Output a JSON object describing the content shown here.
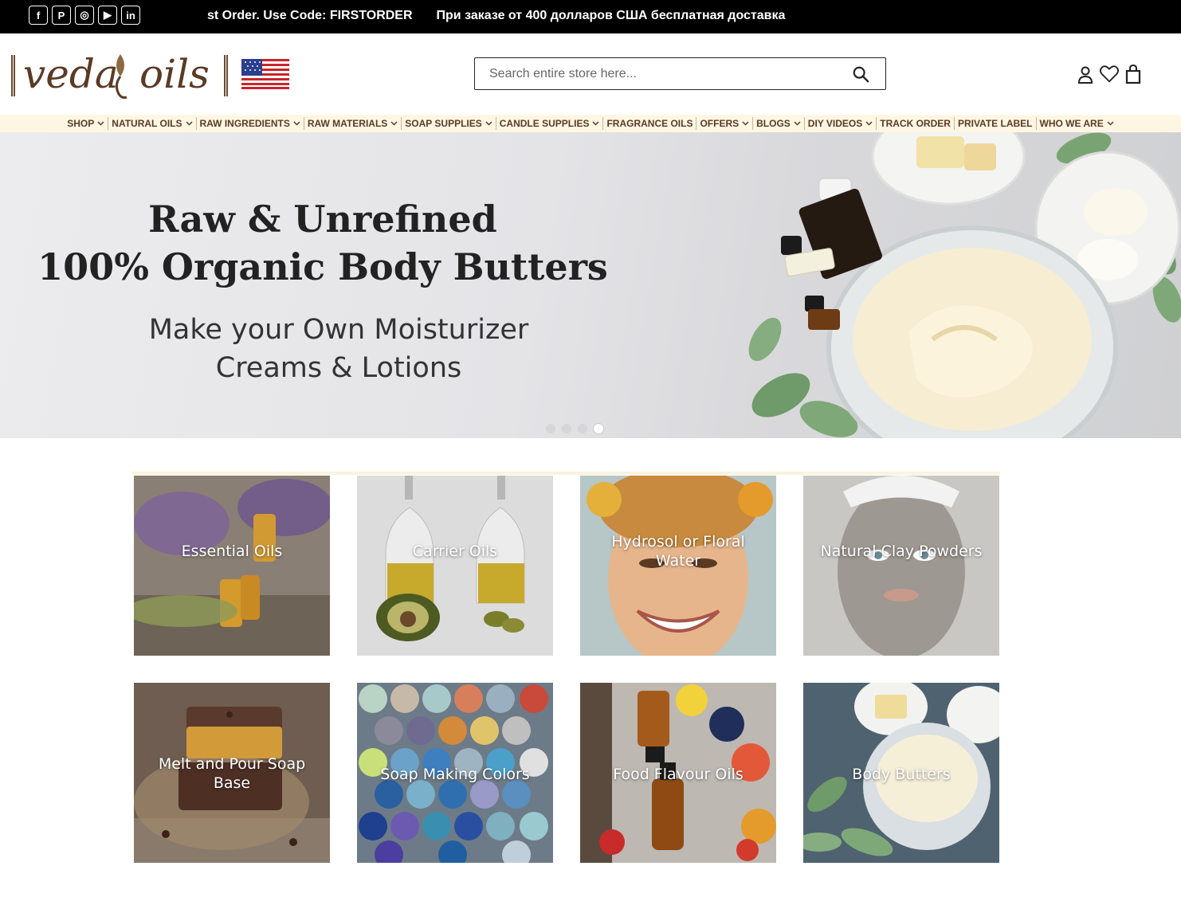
{
  "topbar": {
    "social": [
      {
        "icon": "facebook-icon",
        "glyph": "f"
      },
      {
        "icon": "pinterest-icon",
        "glyph": "P"
      },
      {
        "icon": "instagram-icon",
        "glyph": "◎"
      },
      {
        "icon": "youtube-icon",
        "glyph": "▶"
      },
      {
        "icon": "linkedin-icon",
        "glyph": "in"
      }
    ],
    "promo_1": "st Order. Use Code: FIRSTORDER",
    "promo_2": "При заказе от 400 долларов США бесплатная доставка"
  },
  "header": {
    "logo_text": "Veda oils",
    "search_placeholder": "Search entire store here..."
  },
  "nav": {
    "items": [
      {
        "label": "SHOP",
        "dropdown": true
      },
      {
        "label": "NATURAL OILS",
        "dropdown": true
      },
      {
        "label": "RAW INGREDIENTS",
        "dropdown": true
      },
      {
        "label": "RAW MATERIALS",
        "dropdown": true
      },
      {
        "label": "SOAP SUPPLIES",
        "dropdown": true
      },
      {
        "label": "CANDLE SUPPLIES",
        "dropdown": true
      },
      {
        "label": "FRAGRANCE OILS",
        "dropdown": false
      },
      {
        "label": "OFFERS",
        "dropdown": true
      },
      {
        "label": "BLOGS",
        "dropdown": true
      },
      {
        "label": "DIY VIDEOS",
        "dropdown": true
      },
      {
        "label": "TRACK ORDER",
        "dropdown": false
      },
      {
        "label": "PRIVATE LABEL",
        "dropdown": false
      },
      {
        "label": "WHO WE ARE",
        "dropdown": true
      }
    ]
  },
  "hero": {
    "line1": "Raw & Unrefined",
    "line2": "100% Organic Body Butters",
    "sub1": "Make your Own Moisturizer",
    "sub2": "Creams & Lotions",
    "slides": 4,
    "active_slide": 4
  },
  "categories": [
    {
      "label": "Essential Oils",
      "bg": "#8a7f74"
    },
    {
      "label": "Carrier Oils",
      "bg": "#d4d4d4"
    },
    {
      "label": "Hydrosol or Floral Water",
      "bg": "#b79b77"
    },
    {
      "label": "Natural Clay Powders",
      "bg": "#b9b6b3"
    },
    {
      "label": "Melt and Pour Soap Base",
      "bg": "#5e4a3c"
    },
    {
      "label": "Soap Making Colors",
      "bg": "#6d7b88"
    },
    {
      "label": "Food Flavour Oils",
      "bg": "#6f6a64"
    },
    {
      "label": "Body Butters",
      "bg": "#4f6270"
    }
  ]
}
